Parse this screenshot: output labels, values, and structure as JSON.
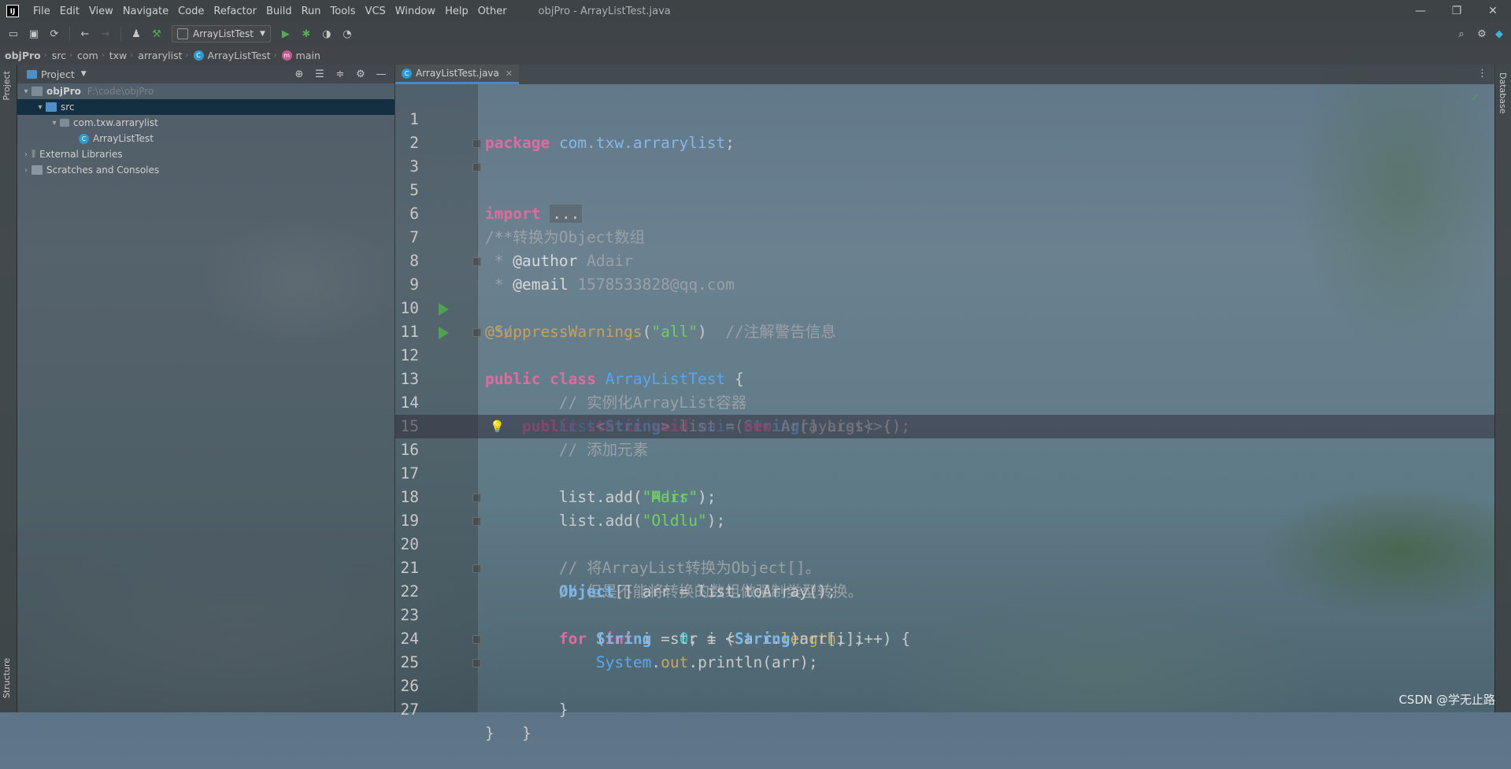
{
  "titlebar": {
    "menu": [
      "File",
      "Edit",
      "View",
      "Navigate",
      "Code",
      "Refactor",
      "Build",
      "Run",
      "Tools",
      "VCS",
      "Window",
      "Help",
      "Other"
    ],
    "window_title": "objPro - ArrayListTest.java",
    "minimize": "—",
    "restore": "❐",
    "close": "✕"
  },
  "toolbar": {
    "run_config": "ArrayListTest"
  },
  "breadcrumb": [
    "objPro",
    "src",
    "com",
    "txw",
    "arrarylist",
    "ArrayListTest",
    "main"
  ],
  "left_stripe": {
    "project_tab": "Project",
    "structure_tab": "Structure"
  },
  "right_stripe": {
    "database_tab": "Database"
  },
  "project_panel": {
    "title": "Project",
    "tree": [
      {
        "label": "objPro",
        "path": "F:\\code\\objPro"
      },
      {
        "label": "src"
      },
      {
        "label": "com.txw.arrarylist"
      },
      {
        "label": "ArrayListTest"
      },
      {
        "label": "External Libraries"
      },
      {
        "label": "Scratches and Consoles"
      }
    ]
  },
  "editor": {
    "tab_label": "ArrayListTest.java",
    "line_numbers": [
      "1",
      "2",
      "3",
      "5",
      "6",
      "7",
      "8",
      "9",
      "10",
      "11",
      "12",
      "13",
      "14",
      "15",
      "16",
      "17",
      "18",
      "19",
      "20",
      "21",
      "22",
      "23",
      "24",
      "25",
      "26",
      "27"
    ],
    "code": {
      "package_kw": "package",
      "package_name": "com.txw.arrarylist",
      "import_kw": "import",
      "import_dots": "...",
      "doc_open": "/**",
      "doc_line1": " * 转换为Object数组",
      "doc_author_tag": "@author",
      "doc_author": "Adair",
      "doc_email_tag": "@email",
      "doc_email": "1578533828@qq.com",
      "doc_close": " */",
      "annotation": "@SuppressWarnings",
      "annotation_arg": "\"all\"",
      "annotation_comment": "//注解警告信息",
      "class_name": "ArrayListTest",
      "method_name": "main",
      "comment_create": "// 实例化ArrayList容器",
      "comment_add": "// 添加元素",
      "str_adir": "\"Adir\"",
      "str_mars": "\"Mars\"",
      "str_oldlu": "\"Oldlu\"",
      "comment_convert": "// 将ArrayList转换为Object[]。",
      "comment_cast": "// 但是不能将转换的数组做强制类型转换。",
      "zero": "0"
    }
  },
  "watermark": "CSDN @学无止路"
}
